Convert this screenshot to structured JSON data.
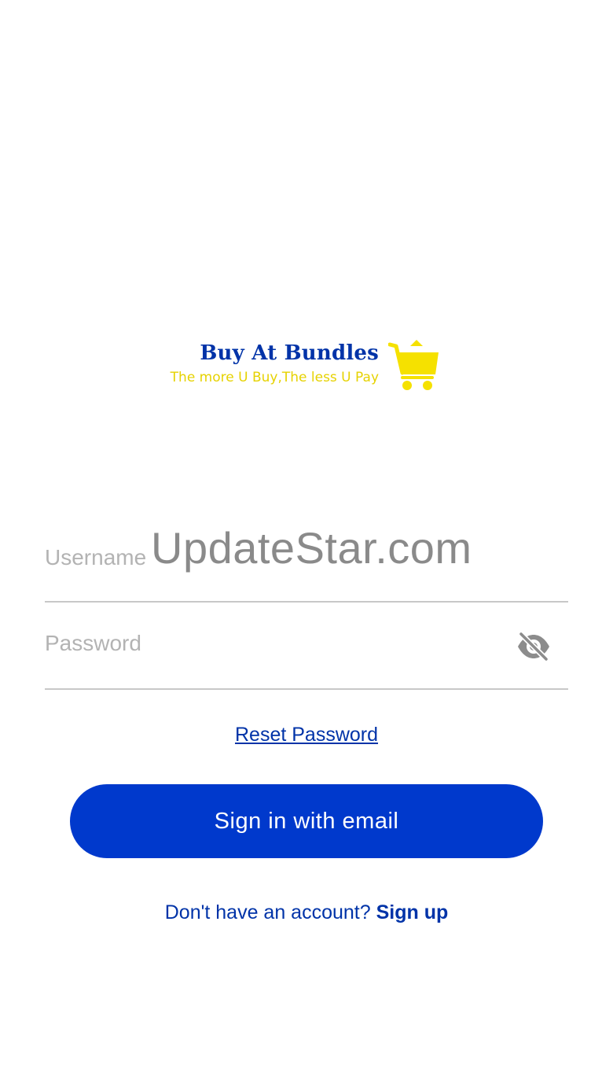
{
  "logo": {
    "title": "Buy At Bundles",
    "tagline": "The more U Buy,The less U Pay",
    "icon": "shopping-cart-icon"
  },
  "form": {
    "username": {
      "label": "Username",
      "value": "UpdateStar.com"
    },
    "password": {
      "label": "Password",
      "toggle_icon": "eye-off-icon"
    }
  },
  "links": {
    "reset_password": "Reset Password"
  },
  "actions": {
    "sign_in_label": "Sign in with email"
  },
  "signup": {
    "prompt": "Don't have an account?",
    "link_label": "Sign up"
  },
  "colors": {
    "brand_blue": "#0039cc",
    "brand_yellow": "#f5e100",
    "label_gray": "#b3b3b3"
  }
}
